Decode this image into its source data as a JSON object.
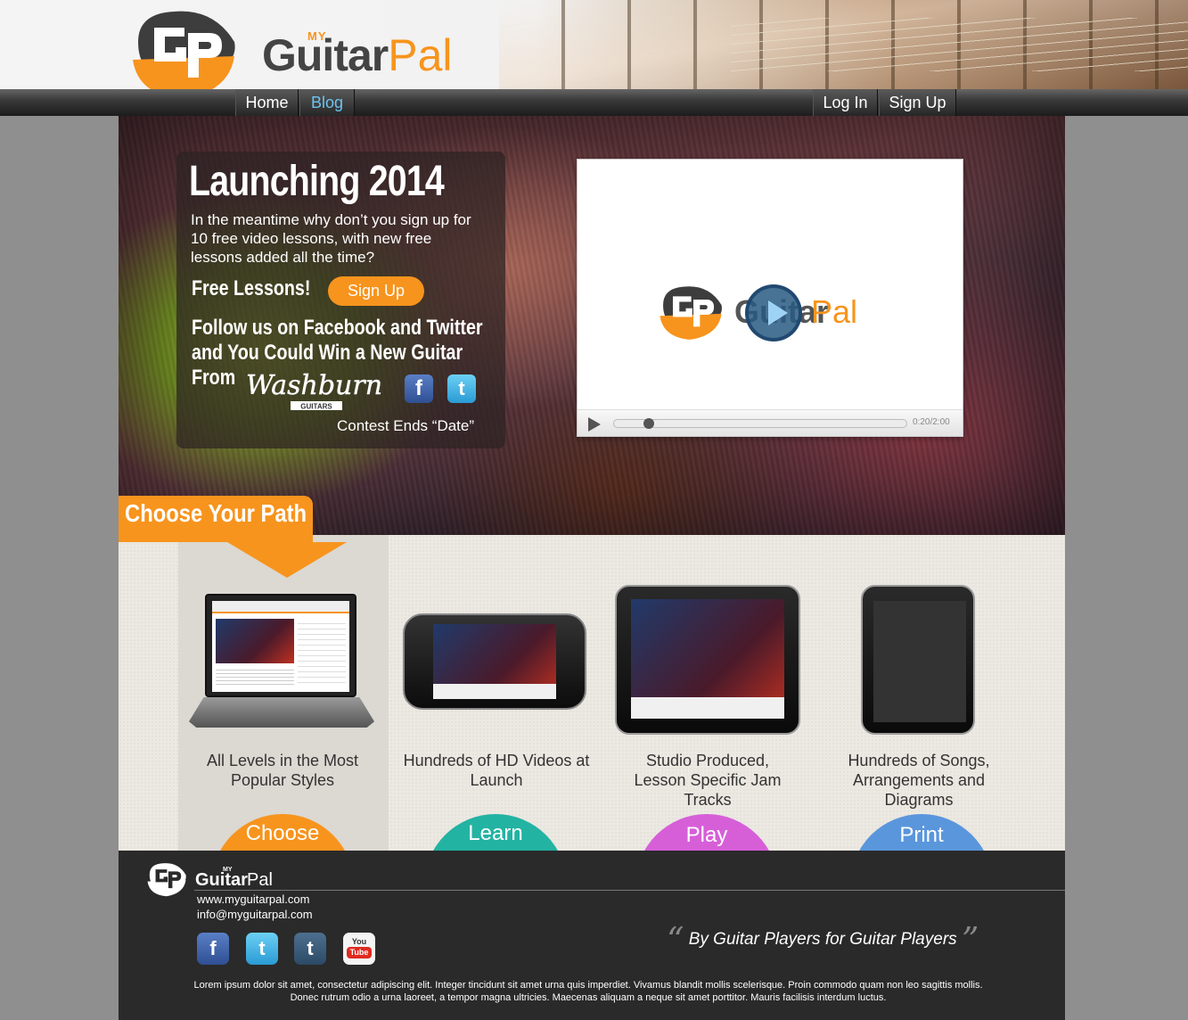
{
  "brand": {
    "logo_initials": "GP",
    "my": "MY",
    "guitar": "Guitar",
    "pal": "Pal"
  },
  "nav": {
    "left": [
      {
        "label": "Home"
      },
      {
        "label": "Blog",
        "active": true
      }
    ],
    "right": [
      {
        "label": "Log In"
      },
      {
        "label": "Sign Up"
      }
    ]
  },
  "promo": {
    "title": "Launching 2014",
    "body": "In the meantime why don’t you sign up for 10 free video lessons, with new free lessons added all the time?",
    "free_lessons": "Free Lessons!",
    "signup_button": "Sign Up",
    "follow": "Follow us on Facebook and Twitter and You Could Win a New Guitar",
    "from": "From",
    "sponsor": "Washburn",
    "sponsor_sub": "GUITARS",
    "contest": "Contest Ends “Date”"
  },
  "video": {
    "guitar": "Guitar",
    "pal": "Pal",
    "time": "0:20/2:00",
    "progress": 0.1
  },
  "choose_path": {
    "heading": "Choose Your Path",
    "items": [
      {
        "caption": "All Levels in the Most Popular Styles",
        "button": "Choose",
        "color": "#f7941d"
      },
      {
        "caption": "Hundreds of HD Videos at Launch",
        "button": "Learn",
        "color": "#23b3a3"
      },
      {
        "caption": "Studio Produced, Lesson Specific Jam Tracks",
        "button": "Play",
        "color": "#d65fd8"
      },
      {
        "caption": "Hundreds of Songs, Arrangements and Diagrams",
        "button": "Print",
        "color": "#5a96dc"
      }
    ]
  },
  "footer": {
    "website": "www.myguitarpal.com",
    "email": "info@myguitarpal.com",
    "social": [
      {
        "icon": "facebook-icon",
        "glyph": "f",
        "color": "#3b5998"
      },
      {
        "icon": "twitter-icon",
        "glyph": "t",
        "color": "#33ace0"
      },
      {
        "icon": "tumblr-icon",
        "glyph": "t",
        "color": "#35536f"
      },
      {
        "icon": "youtube-icon",
        "glyph": "You Tube",
        "color": "#e02a20"
      }
    ],
    "open_quote": "“",
    "tagline": "By Guitar Players for Guitar Players",
    "close_quote": "”",
    "lorem": "Lorem ipsum dolor sit amet, consectetur adipiscing elit. Integer tincidunt sit amet urna quis imperdiet. Vivamus blandit mollis scelerisque. Proin commodo quam non leo sagittis mollis. Donec rutrum odio a urna laoreet, a tempor magna ultricies. Maecenas aliquam a neque sit amet porttitor. Mauris facilisis interdum luctus."
  }
}
